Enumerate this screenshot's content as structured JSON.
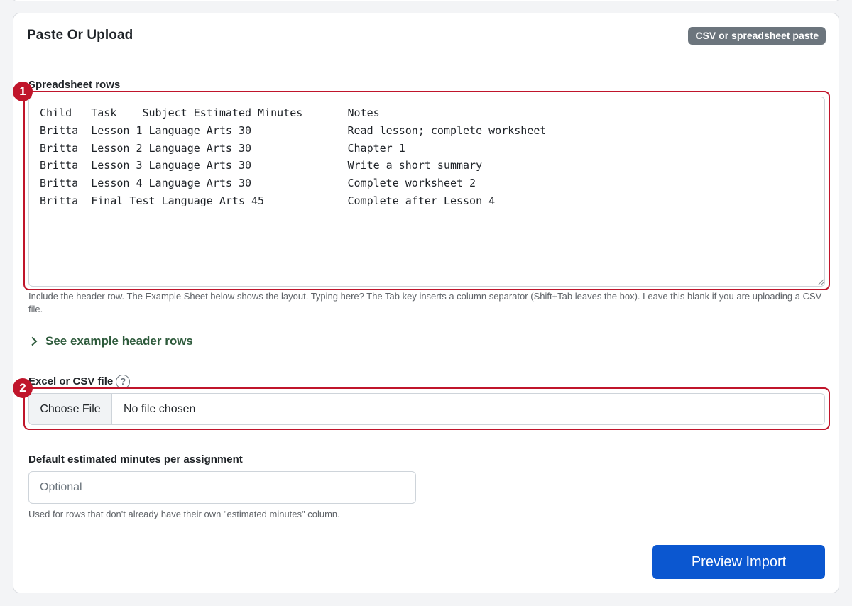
{
  "card": {
    "title": "Paste Or Upload",
    "badge": "CSV or spreadsheet paste"
  },
  "spreadsheet": {
    "label": "Spreadsheet rows",
    "value": "Child\tTask\tSubject\tEstimated Minutes\tNotes\nBritta\tLesson 1\tLanguage Arts\t30\tRead lesson; complete worksheet\nBritta\tLesson 2\tLanguage Arts\t30\tChapter 1\nBritta\tLesson 3\tLanguage Arts\t30\tWrite a short summary\nBritta\tLesson 4\tLanguage Arts\t30\tComplete worksheet 2\nBritta\tFinal Test\tLanguage Arts\t45\tComplete after Lesson 4",
    "help": "Include the header row. The Example Sheet below shows the layout. Typing here? The Tab key inserts a column separator (Shift+Tab leaves the box). Leave this blank if you are uploading a CSV file."
  },
  "example_toggle": {
    "label": "See example header rows"
  },
  "file": {
    "label": "Excel or CSV file",
    "help_icon_text": "?",
    "choose_label": "Choose File",
    "status": "No file chosen"
  },
  "default_minutes": {
    "label": "Default estimated minutes per assignment",
    "placeholder": "Optional",
    "value": "",
    "help": "Used for rows that don't already have their own \"estimated minutes\" column."
  },
  "actions": {
    "preview_label": "Preview Import"
  },
  "annotations": [
    {
      "number": "1"
    },
    {
      "number": "2"
    }
  ],
  "colors": {
    "highlight": "#c0152b",
    "primary": "#0b57d0",
    "badge_bg": "#6c757d",
    "link_green": "#2d5a3b"
  }
}
